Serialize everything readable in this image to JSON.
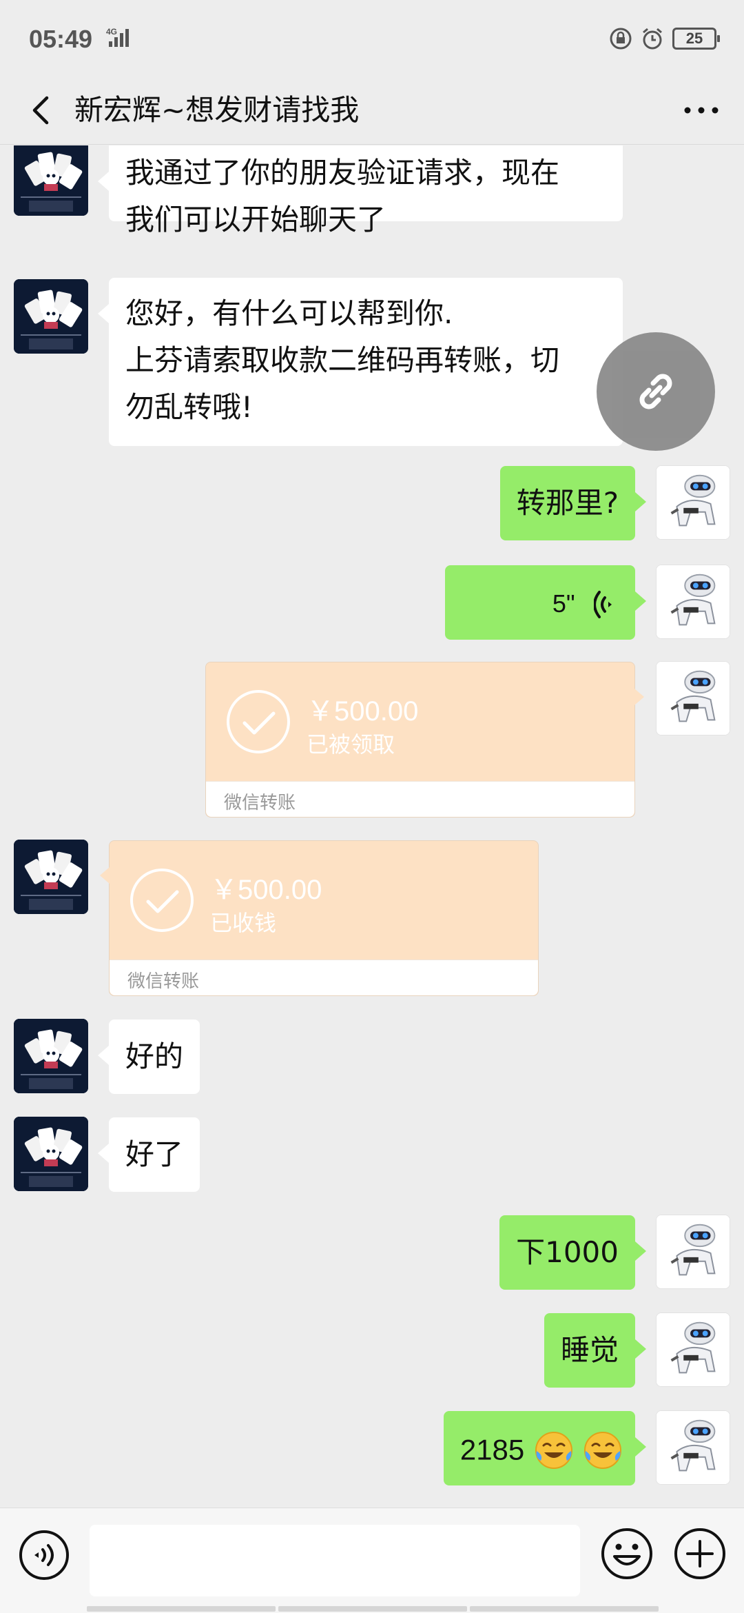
{
  "status_bar": {
    "time": "05:49",
    "network": "4G",
    "battery": "25"
  },
  "header": {
    "title": "新宏辉~想发财请找我"
  },
  "messages": [
    {
      "side": "left",
      "lines": [
        "我通过了你的朋友验证请求，现在",
        "我们可以开始聊天了"
      ]
    },
    {
      "side": "left",
      "lines": [
        "您好，有什么可以帮到你.",
        "上芬请索取收款二维码再转账，切",
        "勿乱转哦!"
      ]
    },
    {
      "side": "right",
      "text": "转那里?"
    },
    {
      "side": "right",
      "type": "voice",
      "duration": "5\""
    },
    {
      "side": "right",
      "type": "transfer",
      "amount": "￥500.00",
      "status": "已被领取",
      "label": "微信转账"
    },
    {
      "side": "left",
      "type": "transfer",
      "amount": "￥500.00",
      "status": "已收钱",
      "label": "微信转账"
    },
    {
      "side": "left",
      "text": "好的"
    },
    {
      "side": "left",
      "text": "好了"
    },
    {
      "side": "right",
      "text": "下1000"
    },
    {
      "side": "right",
      "text": "睡觉"
    },
    {
      "side": "right",
      "text": "2185"
    }
  ],
  "colors": {
    "background": "#ededed",
    "bubble_self": "#95ec69",
    "bubble_other": "#ffffff",
    "transfer": "#fde1c4"
  },
  "input": {
    "value": ""
  }
}
